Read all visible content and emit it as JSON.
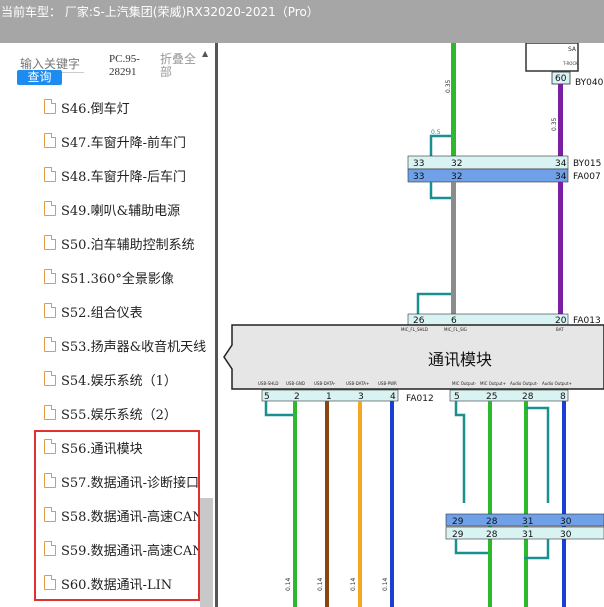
{
  "window": {
    "title": "当前车型：  厂家:S-上汽集团(荣威)RX32020-2021（Pro）"
  },
  "sidebar": {
    "search_placeholder": "输入关键字",
    "search_button": "查询",
    "doc_code": "PC.95-28291",
    "collapse_label": "折叠全部",
    "items": [
      {
        "label": "S46.倒车灯"
      },
      {
        "label": "S47.车窗升降-前车门"
      },
      {
        "label": "S48.车窗升降-后车门"
      },
      {
        "label": "S49.喇叭&辅助电源"
      },
      {
        "label": "S50.泊车辅助控制系统"
      },
      {
        "label": "S51.360°全景影像"
      },
      {
        "label": "S52.组合仪表"
      },
      {
        "label": "S53.扬声器&收音机天线"
      },
      {
        "label": "S54.娱乐系统（1）"
      },
      {
        "label": "S55.娱乐系统（2）"
      },
      {
        "label": "S56.通讯模块"
      },
      {
        "label": "S57.数据通讯-诊断接口"
      },
      {
        "label": "S58.数据通讯-高速CAN"
      },
      {
        "label": "S59.数据通讯-高速CAN"
      },
      {
        "label": "S60.数据通讯-LIN"
      }
    ]
  },
  "diagram": {
    "module_title": "通讯模块",
    "top_connector": {
      "id": "BY040",
      "pin": "60",
      "sub": "SA",
      "sub2": "T-ROCK"
    },
    "connector_by015": {
      "id": "BY015",
      "pins": [
        "33",
        "32",
        "34"
      ]
    },
    "connector_fa007": {
      "id": "FA007",
      "pins": [
        "33",
        "32",
        "34"
      ]
    },
    "connector_fa013": {
      "id": "FA013",
      "pins": [
        "26",
        "6",
        "20"
      ]
    },
    "connector_fa012": {
      "id": "FA012",
      "pins_left": [
        "5",
        "2",
        "1",
        "3",
        "4"
      ],
      "pins_right": [
        "5",
        "25",
        "28",
        "8"
      ]
    },
    "lower_connector_a": {
      "pins": [
        "29",
        "28",
        "31",
        "30"
      ]
    },
    "lower_connector_b": {
      "pins": [
        "29",
        "28",
        "31",
        "30"
      ]
    },
    "module_top_pins": [
      "MIC_FL_SHLD",
      "MIC_FL_SIG",
      "BAT"
    ],
    "module_bottom_pins_left": [
      "USB-SHLD",
      "USB-GND",
      "USB-DATA-",
      "USB-DATA+",
      "USB-PWR"
    ],
    "module_bottom_pins_right": [
      "MIC Output-",
      "MIC Output+",
      "Audio Output-",
      "Audio Output+"
    ],
    "wire_labels": [
      "0.35",
      "0.5",
      "0.35",
      "0.14"
    ],
    "colors": {
      "green": "#2eb82e",
      "teal": "#1a8f8f",
      "gray": "#8c8c8c",
      "purple": "#7b1fa2",
      "brown": "#8b4513",
      "orange": "#f5a623",
      "blue": "#1a3fd6",
      "connector_light": "#d9f2f2",
      "connector_blue": "#6fa0e8",
      "red_box": "#e03030"
    }
  }
}
